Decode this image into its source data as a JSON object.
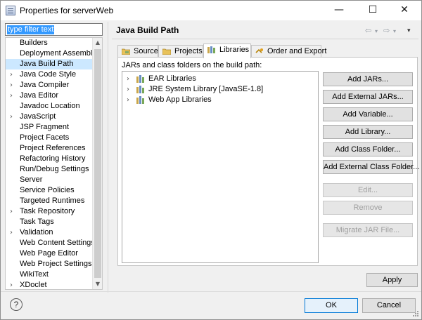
{
  "window": {
    "title": "Properties for serverWeb",
    "minimize": "—",
    "maximize": "☐",
    "close": "✕"
  },
  "filter": {
    "placeholder": "type filter text"
  },
  "tree": {
    "items": [
      {
        "label": "Builders",
        "expandable": false
      },
      {
        "label": "Deployment Assembly",
        "expandable": false
      },
      {
        "label": "Java Build Path",
        "expandable": false,
        "selected": true
      },
      {
        "label": "Java Code Style",
        "expandable": true
      },
      {
        "label": "Java Compiler",
        "expandable": true
      },
      {
        "label": "Java Editor",
        "expandable": true
      },
      {
        "label": "Javadoc Location",
        "expandable": false
      },
      {
        "label": "JavaScript",
        "expandable": true
      },
      {
        "label": "JSP Fragment",
        "expandable": false
      },
      {
        "label": "Project Facets",
        "expandable": false
      },
      {
        "label": "Project References",
        "expandable": false
      },
      {
        "label": "Refactoring History",
        "expandable": false
      },
      {
        "label": "Run/Debug Settings",
        "expandable": false
      },
      {
        "label": "Server",
        "expandable": false
      },
      {
        "label": "Service Policies",
        "expandable": false
      },
      {
        "label": "Targeted Runtimes",
        "expandable": false
      },
      {
        "label": "Task Repository",
        "expandable": true
      },
      {
        "label": "Task Tags",
        "expandable": false
      },
      {
        "label": "Validation",
        "expandable": true
      },
      {
        "label": "Web Content Settings",
        "expandable": false
      },
      {
        "label": "Web Page Editor",
        "expandable": false
      },
      {
        "label": "Web Project Settings",
        "expandable": false
      },
      {
        "label": "WikiText",
        "expandable": false
      },
      {
        "label": "XDoclet",
        "expandable": true
      }
    ]
  },
  "page": {
    "title": "Java Build Path",
    "nav_back": "⇦",
    "nav_forward": "⇨",
    "nav_menu": "▾"
  },
  "tabs": [
    {
      "label": "Source",
      "icon": "source-folder-icon",
      "active": false
    },
    {
      "label": "Projects",
      "icon": "projects-folder-icon",
      "active": false
    },
    {
      "label": "Libraries",
      "icon": "libraries-icon",
      "active": true
    },
    {
      "label": "Order and Export",
      "icon": "order-export-icon",
      "active": false
    }
  ],
  "libraries": {
    "heading": "JARs and class folders on the build path:",
    "items": [
      {
        "label": "EAR Libraries",
        "icon": "library-icon"
      },
      {
        "label": "JRE System Library [JavaSE-1.8]",
        "icon": "library-icon"
      },
      {
        "label": "Web App Libraries",
        "icon": "library-icon"
      }
    ]
  },
  "buttons": [
    {
      "label": "Add JARs...",
      "enabled": true
    },
    {
      "label": "Add External JARs...",
      "enabled": true
    },
    {
      "label": "Add Variable...",
      "enabled": true
    },
    {
      "label": "Add Library...",
      "enabled": true
    },
    {
      "label": "Add Class Folder...",
      "enabled": true
    },
    {
      "label": "Add External Class Folder...",
      "enabled": true
    },
    {
      "label": "Edit...",
      "enabled": false
    },
    {
      "label": "Remove",
      "enabled": false
    },
    {
      "label": "Migrate JAR File...",
      "enabled": false
    }
  ],
  "footer": {
    "apply": "Apply",
    "help": "?",
    "ok": "OK",
    "cancel": "Cancel"
  },
  "colors": {
    "selection": "#cce8ff",
    "filter_highlight": "#3399ff",
    "default_button_border": "#0078d7"
  }
}
